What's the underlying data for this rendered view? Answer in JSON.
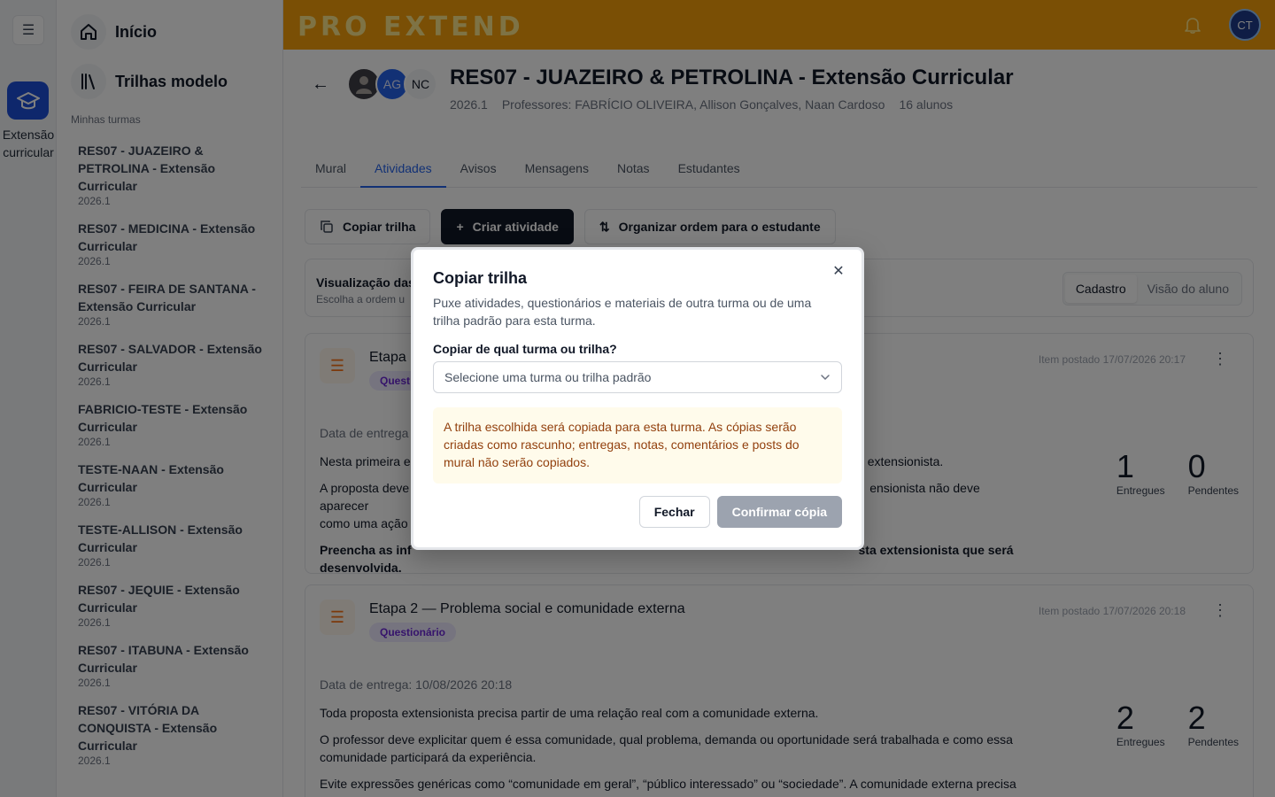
{
  "rail": {
    "course_label": "Extensão curricular"
  },
  "sidebar": {
    "nav": [
      {
        "label": "Início"
      },
      {
        "label": "Trilhas modelo"
      }
    ],
    "section_label": "Minhas turmas",
    "turmas": [
      {
        "name": "RES07 - JUAZEIRO & PETROLINA - Extensão Curricular",
        "term": "2026.1"
      },
      {
        "name": "RES07 - MEDICINA - Extensão Curricular",
        "term": "2026.1"
      },
      {
        "name": "RES07 - FEIRA DE SANTANA - Extensão Curricular",
        "term": "2026.1"
      },
      {
        "name": "RES07 - SALVADOR - Extensão Curricular",
        "term": "2026.1"
      },
      {
        "name": "FABRICIO-TESTE - Extensão Curricular",
        "term": "2026.1"
      },
      {
        "name": "TESTE-NAAN - Extensão Curricular",
        "term": "2026.1"
      },
      {
        "name": "TESTE-ALLISON - Extensão Curricular",
        "term": "2026.1"
      },
      {
        "name": "RES07 - JEQUIE - Extensão Curricular",
        "term": "2026.1"
      },
      {
        "name": "RES07 - ITABUNA - Extensão Curricular",
        "term": "2026.1"
      },
      {
        "name": "RES07 - VITÓRIA DA CONQUISTA - Extensão Curricular",
        "term": "2026.1"
      }
    ]
  },
  "topbar": {
    "logo": "PRO EXTEND",
    "user_initials": "CT",
    "brand_color": "#f59e0b"
  },
  "course": {
    "avatars": [
      "AG",
      "NC"
    ],
    "title": "RES07 - JUAZEIRO & PETROLINA - Extensão Curricular",
    "term": "2026.1",
    "professors": "Professores: FABRÍCIO OLIVEIRA, Allison Gonçalves, Naan Cardoso",
    "students": "16 alunos"
  },
  "tabs": [
    {
      "label": "Mural",
      "active": false
    },
    {
      "label": "Atividades",
      "active": true
    },
    {
      "label": "Avisos",
      "active": false
    },
    {
      "label": "Mensagens",
      "active": false
    },
    {
      "label": "Notas",
      "active": false
    },
    {
      "label": "Estudantes",
      "active": false
    }
  ],
  "actions": {
    "copy": "Copiar trilha",
    "create": "Criar atividade",
    "organize": "Organizar ordem para o estudante"
  },
  "view": {
    "title": "Visualização das",
    "sub": "Escolha a ordem u",
    "options": [
      "Cadastro",
      "Visão do aluno"
    ],
    "selected": "Cadastro"
  },
  "activities": [
    {
      "title": "Etapa",
      "tag": "Quest",
      "posted": "Item postado 17/07/2026 20:17",
      "due": "Data de entrega",
      "p1": "Nesta primeira e",
      "p1_end": "extensionista.",
      "p2": "A proposta deve",
      "p2_end": "ensionista não deve aparecer",
      "p2b": "como uma ação",
      "p3": "Preencha as inf",
      "p3_end": "sta extensionista que será",
      "p3b": "desenvolvida.",
      "delivered": "1",
      "pending": "0"
    },
    {
      "title": "Etapa 2 — Problema social e comunidade externa",
      "tag": "Questionário",
      "posted": "Item postado 17/07/2026 20:18",
      "due": "Data de entrega: 10/08/2026 20:18",
      "p1": "Toda proposta extensionista precisa partir de uma relação real com a comunidade externa.",
      "p2": "O professor deve explicitar quem é essa comunidade, qual problema, demanda ou oportunidade será trabalhada e como essa comunidade participará da experiência.",
      "p3": "Evite expressões genéricas como “comunidade em geral”, “público interessado” ou “sociedade”. A comunidade externa precisa",
      "delivered": "2",
      "pending": "2"
    }
  ],
  "stats_labels": {
    "delivered": "Entregues",
    "pending": "Pendentes"
  },
  "modal": {
    "title": "Copiar trilha",
    "description": "Puxe atividades, questionários e materiais de outra turma ou de uma trilha padrão para esta turma.",
    "field_label": "Copiar de qual turma ou trilha?",
    "select_placeholder": "Selecione uma turma ou trilha padrão",
    "warning": "A trilha escolhida será copiada para esta turma. As cópias serão criadas como rascunho; entregas, notas, comentários e posts do mural não serão copiados.",
    "cancel": "Fechar",
    "confirm": "Confirmar cópia"
  }
}
